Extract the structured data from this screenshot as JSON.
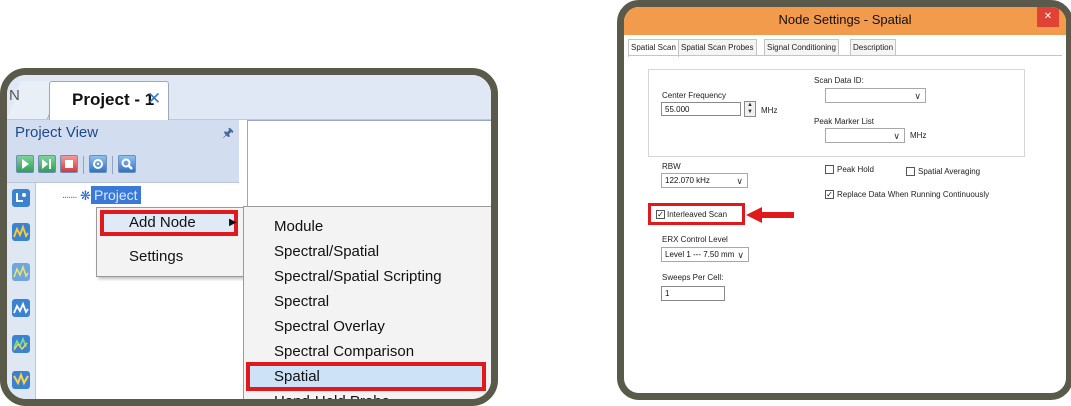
{
  "left": {
    "prev_tab_label": "N",
    "active_tab_label": "Project - 1",
    "tab_close": "✕",
    "project_view_title": "Project View",
    "pin_icon": "pin-icon",
    "tree_root_label": "Project",
    "context_menu": {
      "add_node": "Add Node",
      "settings": "Settings"
    },
    "submenu": [
      "Module",
      "Spectral/Spatial",
      "Spectral/Spatial Scripting",
      "Spectral",
      "Spectral Overlay",
      "Spectral Comparison",
      "Spatial",
      "Hand-Held Probe"
    ],
    "highlighted_submenu_item": "Spatial"
  },
  "dialog": {
    "title": "Node Settings - Spatial",
    "tabs": [
      "Spatial Scan",
      "Spatial Scan Probes",
      "Signal Conditioning",
      "Description"
    ],
    "active_tab": "Spatial Scan",
    "center_frequency_label": "Center Frequency",
    "center_frequency_value": "55.000",
    "center_frequency_unit": "MHz",
    "scan_data_id_label": "Scan Data ID:",
    "scan_data_id_value": "",
    "peak_marker_list_label": "Peak Marker List",
    "peak_marker_unit": "MHz",
    "rbw_label": "RBW",
    "rbw_value": "122.070 kHz",
    "peak_hold_label": "Peak Hold",
    "peak_hold_checked": false,
    "spatial_averaging_label": "Spatial Averaging",
    "spatial_averaging_checked": false,
    "replace_data_label": "Replace Data When Running Continuously",
    "replace_data_checked": true,
    "interleaved_scan_label": "Interleaved Scan",
    "interleaved_scan_checked": true,
    "erx_label": "ERX Control Level",
    "erx_value": "Level 1 --- 7.50 mm",
    "sweeps_label": "Sweeps Per Cell:",
    "sweeps_value": "1"
  },
  "colors": {
    "highlight_red": "#e0191d",
    "dialog_title_bar": "#f39b4d",
    "frame": "#5a5a4a",
    "tree_selection": "#3a79d8"
  }
}
